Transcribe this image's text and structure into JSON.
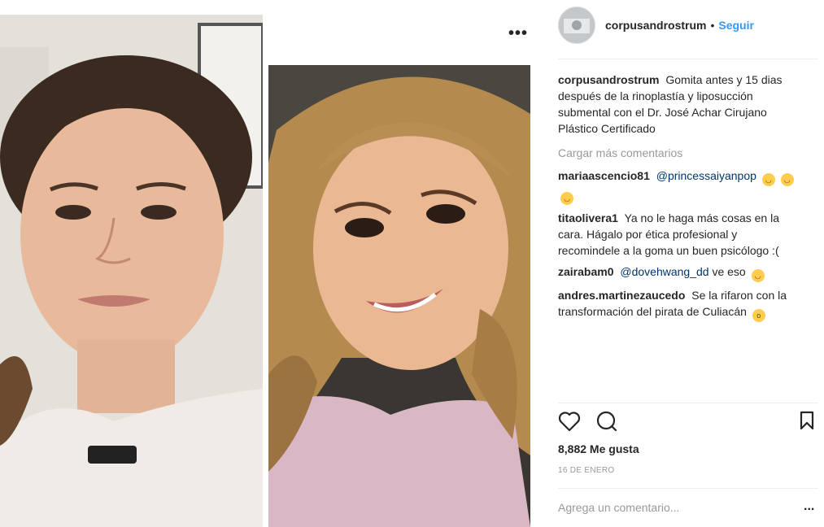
{
  "post": {
    "username": "corpusandrostrum",
    "follow_label": "Seguir",
    "dot": "•",
    "more_label": "•••",
    "caption": "Gomita antes y 15 dias después de la rinoplastía y liposucción submental con el Dr. José Achar Cirujano Plástico Certificado",
    "load_more": "Cargar más comentarios",
    "likes": "8,882 Me gusta",
    "date": "16 DE ENERO",
    "comment_placeholder": "Agrega un comentario...",
    "comment_more": "..."
  },
  "comments": [
    {
      "user": "mariaascencio81",
      "mention": "@princessaiyanpop",
      "text": ""
    },
    {
      "user": "titaolivera1",
      "mention": "",
      "text": "Ya no le haga más cosas en la cara. Hágalo por ética profesional y recomindele a la goma un buen psicólogo :("
    },
    {
      "user": "zairabam0",
      "mention": "@dovehwang_dd",
      "text": "ve eso"
    },
    {
      "user": "andres.martinezaucedo",
      "mention": "",
      "text": "Se la rifaron con la transformación del pirata de Culiacán"
    }
  ],
  "icons": [
    "heart-icon",
    "comment-icon",
    "bookmark-icon"
  ],
  "colors": {
    "link": "#3897f0",
    "mention": "#003569",
    "muted": "#999999",
    "text": "#262626"
  }
}
